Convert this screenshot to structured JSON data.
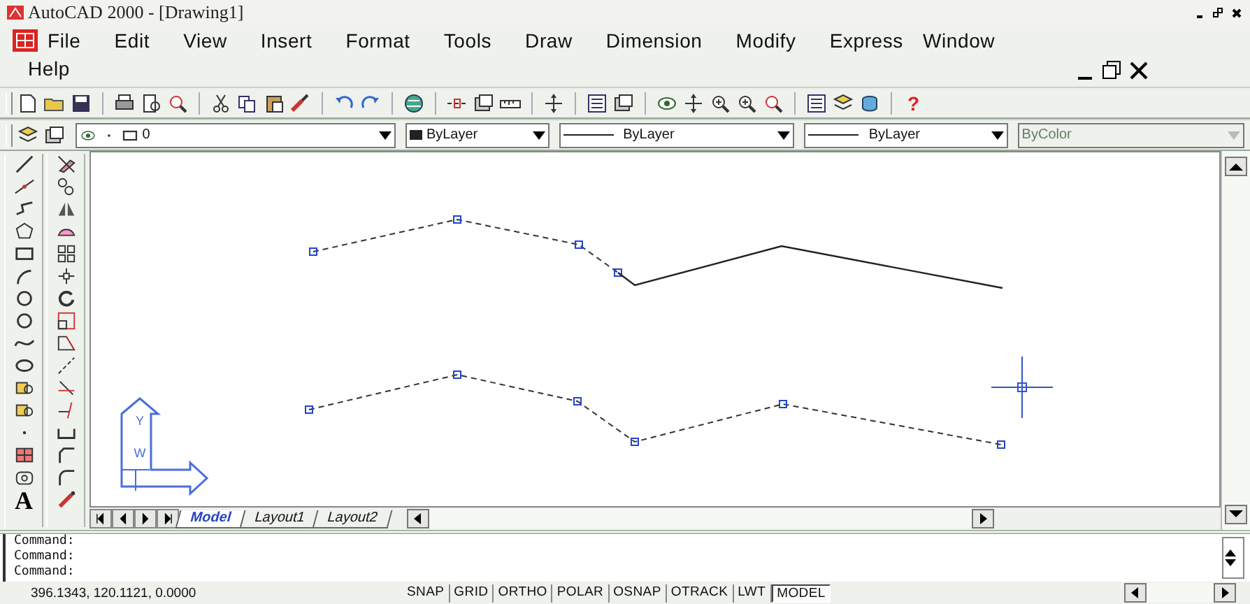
{
  "window": {
    "title": "AutoCAD 2000 - [Drawing1]"
  },
  "menu": [
    "File",
    "Edit",
    "View",
    "Insert",
    "Format",
    "Tools",
    "Draw",
    "Dimension",
    "Modify",
    "Express",
    "Window",
    "Help"
  ],
  "standard_toolbar": {
    "help_button": "?"
  },
  "properties_toolbar": {
    "layer": "0",
    "dropdowns": [
      {
        "kind": "color",
        "value": "ByLayer",
        "disabled": false
      },
      {
        "kind": "linetype",
        "value": "ByLayer",
        "disabled": false
      },
      {
        "kind": "lineweight",
        "value": "ByLayer",
        "disabled": false
      },
      {
        "kind": "plotstyle",
        "value": "ByColor",
        "disabled": true
      }
    ]
  },
  "draw_toolbar": {
    "text_tool": "A"
  },
  "ucs_icon": {
    "y_label": "Y",
    "w_label": "W"
  },
  "tabs": [
    {
      "label": "Model",
      "selected": true
    },
    {
      "label": "Layout1",
      "selected": false
    },
    {
      "label": "Layout2",
      "selected": false
    }
  ],
  "command_lines": [
    "Command:",
    "Command:",
    "Command:"
  ],
  "status_bar": {
    "coordinates": "396.1343, 120.1121, 0.0000",
    "toggles": [
      {
        "label": "SNAP",
        "on": false
      },
      {
        "label": "GRID",
        "on": false
      },
      {
        "label": "ORTHO",
        "on": false
      },
      {
        "label": "POLAR",
        "on": false
      },
      {
        "label": "OSNAP",
        "on": false
      },
      {
        "label": "OTRACK",
        "on": false
      },
      {
        "label": "LWT",
        "on": false
      },
      {
        "label": "MODEL",
        "on": true
      }
    ]
  }
}
